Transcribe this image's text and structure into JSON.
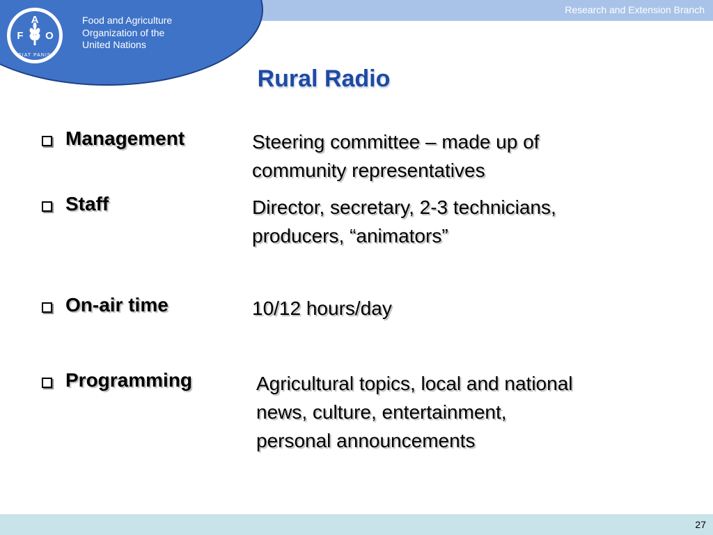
{
  "header": {
    "branch": "Research and Extension Branch",
    "org_name": [
      "Food and Agriculture",
      "Organization of the",
      "United Nations"
    ],
    "emblem_letters": [
      "F",
      "A",
      "O"
    ],
    "emblem_motto": "FIAT PANIS"
  },
  "title": "Rural Radio",
  "items": [
    {
      "term": "Management",
      "description": [
        "Steering committee – made up of",
        "community representatives"
      ]
    },
    {
      "term": "Staff",
      "description": [
        "Director, secretary, 2-3 technicians,",
        "producers, “animators”"
      ]
    },
    {
      "term": "On-air time",
      "description": [
        "10/12 hours/day"
      ]
    },
    {
      "term": "Programming",
      "description": [
        "Agricultural topics, local and national",
        "news, culture, entertainment,",
        "personal announcements"
      ]
    }
  ],
  "footer": {
    "page_number": "27"
  },
  "colors": {
    "top_band": "#a9c3e8",
    "fao_blue": "#3f73c7",
    "title_blue": "#1f4aa3",
    "bottom_band": "#c8e3ea"
  }
}
